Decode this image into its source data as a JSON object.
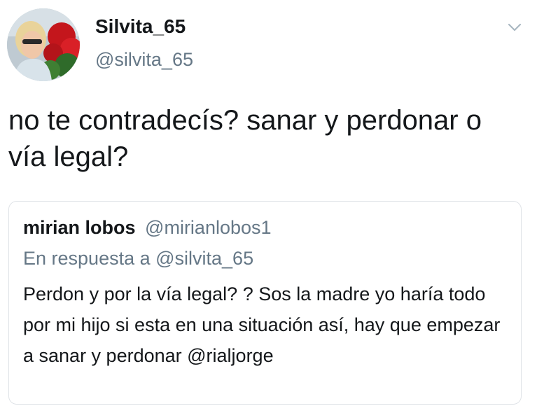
{
  "tweet": {
    "display_name": "Silvita_65",
    "handle": "@silvita_65",
    "avatar_icon": "profile-photo",
    "menu_icon": "chevron-down-icon",
    "text": "no te contradecís? sanar y perdonar o vía legal?"
  },
  "quoted_tweet": {
    "display_name": "mirian lobos",
    "handle": "@mirianlobos1",
    "reply_context": "En respuesta a @silvita_65",
    "text": "Perdon y por la vía legal? ? Sos la madre yo haría todo por mi hijo si esta en una situación así, hay que empezar a sanar y perdonar @rialjorge"
  },
  "colors": {
    "text_primary": "#14171a",
    "text_secondary": "#657786",
    "border": "#dfe3e7",
    "caret": "#aab8c2"
  }
}
